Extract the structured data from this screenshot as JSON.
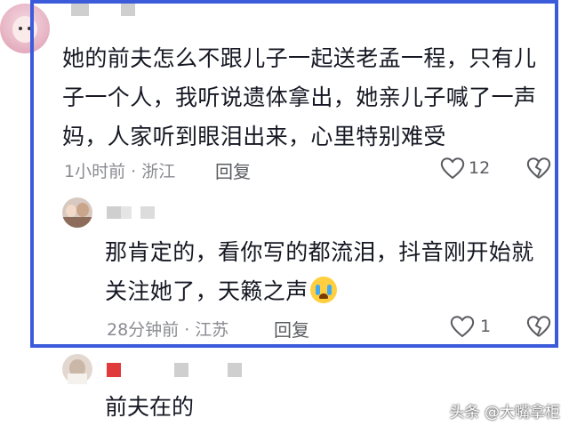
{
  "comments": [
    {
      "text": "她的前夫怎么不跟儿子一起送老孟一程，只有儿子一个人，我听说遗体拿出，她亲儿子喊了一声妈，人家听到眼泪出来，心里特别难受",
      "meta": "1小时前 · 浙江",
      "reply_label": "回复",
      "likes": "12",
      "replies": [
        {
          "text": "那肯定的，看你写的都流泪，抖音刚开始就关注她了，天籁之声",
          "emoji": "loudly-crying-face",
          "meta": "28分钟前 · 江苏",
          "reply_label": "回复",
          "likes": "1"
        }
      ]
    },
    {
      "text": "前夫在的"
    }
  ],
  "watermark": "头条 @大嘴拿柜",
  "colors": {
    "highlight_border": "#3b5bdb",
    "meta_text": "#8a8b91"
  },
  "icons": [
    "heart-outline-icon",
    "broken-heart-icon",
    "crying-emoji-icon"
  ]
}
